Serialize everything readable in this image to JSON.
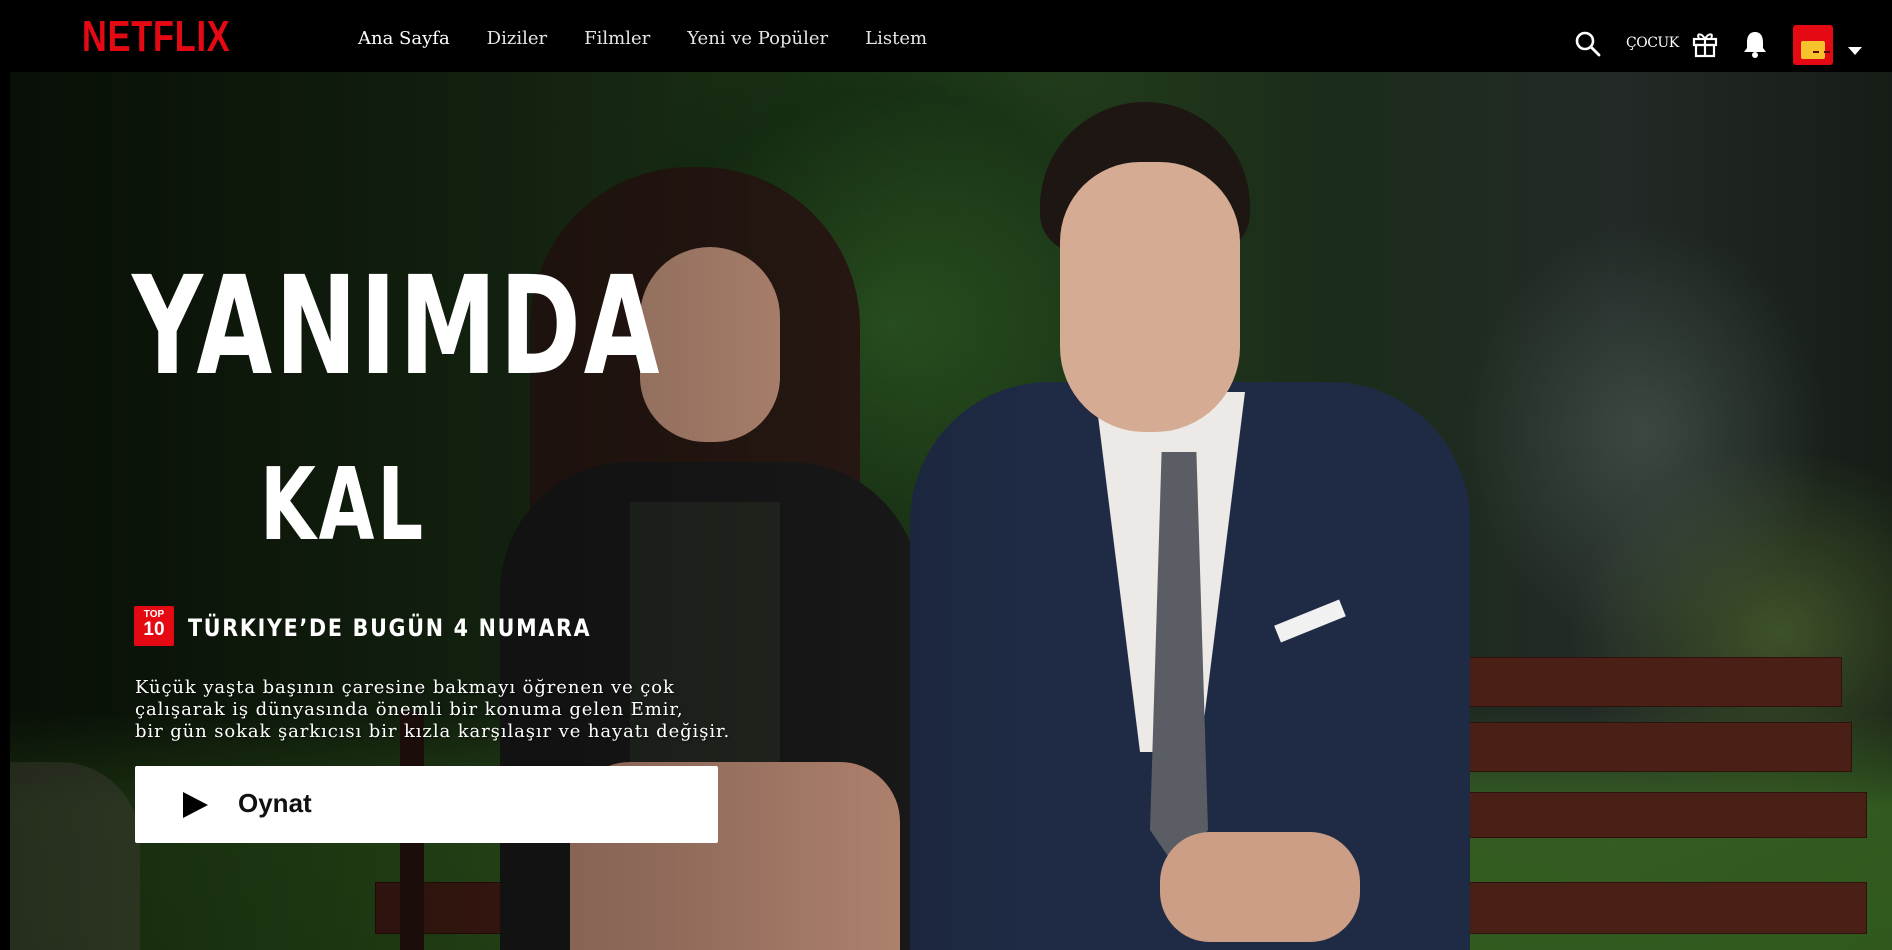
{
  "header": {
    "logo": "NETFLIX",
    "nav": [
      "Ana Sayfa",
      "Diziler",
      "Filmler",
      "Yeni ve Popüler",
      "Listem"
    ],
    "kids_label": "ÇOCUK",
    "icons": [
      "search-icon",
      "gift-icon",
      "bell-icon",
      "profile-avatar",
      "caret-down-icon"
    ]
  },
  "hero": {
    "title_line1": "YANIMDA",
    "title_line2": "KAL",
    "top10_badge_top": "TOP",
    "top10_badge_num": "10",
    "rank_text": "TÜRKIYE’DE BUGÜN 4 NUMARA",
    "synopsis_lines": [
      "Küçük yaşta başının çaresine bakmayı öğrenen ve çok",
      "çalışarak iş dünyasında önemli bir konuma gelen Emir,",
      "bir gün sokak şarkıcısı bir kızla karşılaşır ve hayatı değişir."
    ],
    "play_label": "Oynat"
  },
  "colors": {
    "brand": "#e50914",
    "header_bg": "#000000",
    "play_bg": "#ffffff"
  }
}
